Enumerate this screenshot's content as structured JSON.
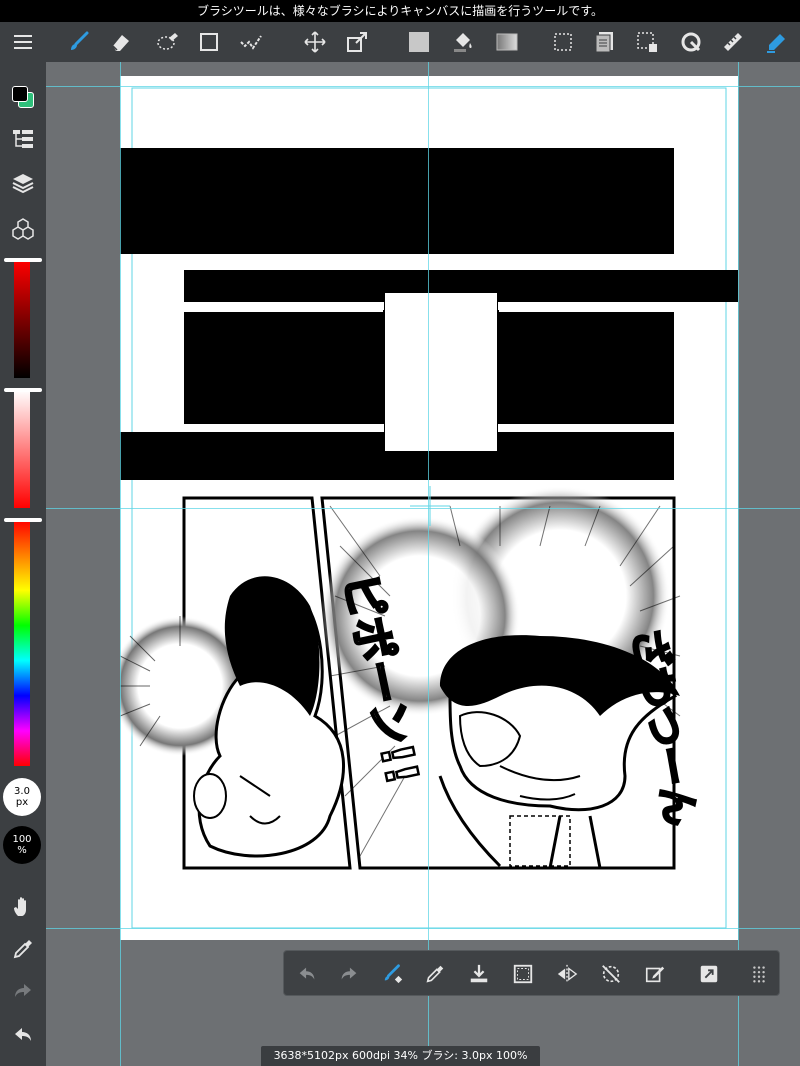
{
  "status_bar": {
    "message": "ブラシツールは、様々なブラシによりキャンバスに描画を行うツールです。"
  },
  "toolbar": {
    "tools": [
      {
        "name": "menu-icon"
      },
      {
        "name": "brush-icon",
        "active": true
      },
      {
        "name": "eraser-icon"
      },
      {
        "name": "lasso-eraser-icon"
      },
      {
        "name": "rectangle-icon"
      },
      {
        "name": "select-pen-icon"
      },
      {
        "name": "move-icon"
      },
      {
        "name": "transform-icon"
      },
      {
        "name": "fill-icon"
      },
      {
        "name": "bucket-icon"
      },
      {
        "name": "gradient-icon"
      },
      {
        "name": "selection-icon"
      },
      {
        "name": "copy-layer-icon"
      },
      {
        "name": "lasso-select-icon"
      },
      {
        "name": "rotate-icon"
      },
      {
        "name": "ruler-icon"
      },
      {
        "name": "auto-select-icon"
      }
    ],
    "accent_color": "#2e9be0"
  },
  "sidebar": {
    "primary_color": "#000000",
    "secondary_color": "#2ebf7a",
    "brush_size": {
      "value": "3.0",
      "unit": "px"
    },
    "opacity": {
      "value": "100",
      "unit": "%"
    },
    "sliders": {
      "brightness_level": 1.0,
      "saturation_level": 0.0,
      "hue_level": 0.0
    }
  },
  "canvas": {
    "page_background": "#ffffff",
    "workspace_background": "#6d7073",
    "guide_color": "#5fd6e6",
    "sfx_text_left": "ピポーン!!",
    "sfx_text_right": "ざわつーん"
  },
  "bottom_toolbar": {
    "tools": [
      {
        "name": "undo-icon"
      },
      {
        "name": "redo-icon"
      },
      {
        "name": "brush-eraser-toggle-icon"
      },
      {
        "name": "eyedropper-icon"
      },
      {
        "name": "download-icon"
      },
      {
        "name": "select-all-icon"
      },
      {
        "name": "flip-icon"
      },
      {
        "name": "rotate-reset-icon"
      },
      {
        "name": "edit-icon"
      },
      {
        "name": "fit-screen-icon"
      },
      {
        "name": "grid-menu-icon"
      }
    ]
  },
  "info_bar": {
    "text": "3638*5102px 600dpi 34% ブラシ: 3.0px 100%"
  }
}
